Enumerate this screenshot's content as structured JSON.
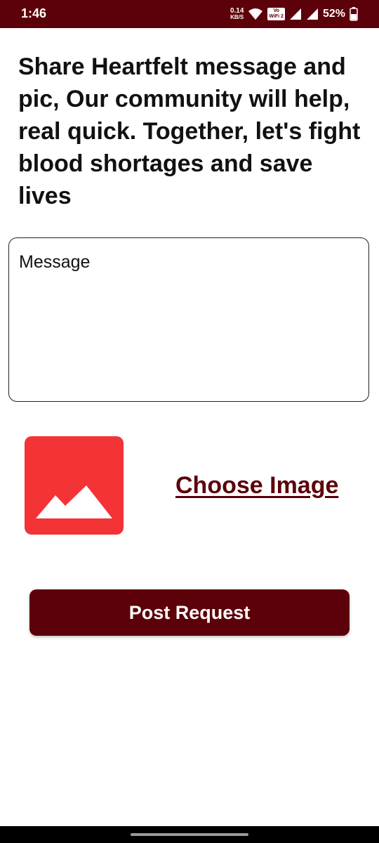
{
  "status_bar": {
    "time": "1:46",
    "net_speed_value": "0.14",
    "net_speed_unit": "KB/S",
    "volte_top": "Vo",
    "volte_bottom": "WiFi 2",
    "battery": "52%"
  },
  "heading": "Share Heartfelt message and pic, Our community will help, real quick. Together, let's fight blood shortages and save lives",
  "message": {
    "placeholder": "Message",
    "value": ""
  },
  "image": {
    "icon": "image-placeholder-icon",
    "choose_label": "Choose Image"
  },
  "post_button_label": "Post Request",
  "colors": {
    "primary": "#5c0009",
    "image_placeholder": "#f33336"
  }
}
